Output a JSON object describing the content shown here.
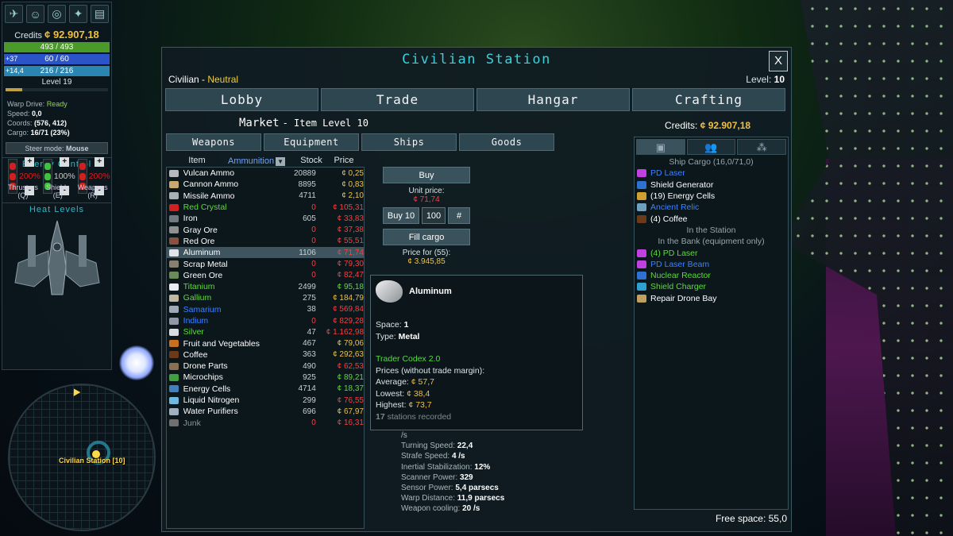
{
  "hud": {
    "credits_label": "Credits",
    "credits_value": "¢ 92.907,18",
    "hull": "493 / 493",
    "shield_side": "+37",
    "shield": "60 / 60",
    "energy_side": "+14,4",
    "energy": "216 / 216",
    "level": "Level 19",
    "stats": {
      "warp_label": "Warp Drive:",
      "warp_value": "Ready",
      "speed_label": "Speed:",
      "speed_value": "0,0",
      "coords_label": "Coords:",
      "coords_value": "(576, 412)",
      "cargo_label": "Cargo:",
      "cargo_value": "16/71 (23%)"
    },
    "steer_label": "Steer mode:",
    "steer_value": "Mouse",
    "energy_title": "Energy Control",
    "energy_cols": [
      {
        "pct": "200%",
        "label": "Thrusters",
        "key": "(Q)",
        "color": "#d02020"
      },
      {
        "pct": "100%",
        "label": "Shields",
        "key": "(E)",
        "color": "#40c040"
      },
      {
        "pct": "200%",
        "label": "Weapons",
        "key": "(R)",
        "color": "#d02020"
      }
    ],
    "heat_title": "Heat Levels"
  },
  "minimap": {
    "label": "Civilian Station [10]"
  },
  "window": {
    "title": "Civilian Station",
    "close": "X",
    "faction_name": "Civilian - ",
    "faction_status": "Neutral",
    "level_label": "Level: ",
    "level_value": "10",
    "tabs": [
      "Lobby",
      "Trade",
      "Hangar",
      "Crafting"
    ],
    "market_title": "Market",
    "market_sub": "- Item Level 10",
    "credits_label": "Credits: ",
    "credits_value": "¢ 92.907,18",
    "subtabs": [
      "Weapons",
      "Equipment",
      "Ships",
      "Goods"
    ]
  },
  "list": {
    "headers": {
      "item": "Item",
      "filter": "Ammunition",
      "stock": "Stock",
      "price": "Price"
    },
    "rows": [
      {
        "name": "Vulcan Ammo",
        "stock": "20889",
        "price": "¢ 0,25",
        "nc": "#ffffff",
        "pc": "#f0c040",
        "ic": "#b8b8c0"
      },
      {
        "name": "Cannon Ammo",
        "stock": "8895",
        "price": "¢ 0,83",
        "nc": "#ffffff",
        "pc": "#f0c040",
        "ic": "#c8a870"
      },
      {
        "name": "Missile Ammo",
        "stock": "4711",
        "price": "¢ 2,10",
        "nc": "#ffffff",
        "pc": "#f0c040",
        "ic": "#a8b0b8"
      },
      {
        "name": "Red Crystal",
        "stock": "0",
        "price": "¢ 105,31",
        "nc": "#5adc36",
        "pc": "#ff3c3c",
        "ic": "#d02020",
        "sc": "#ff3c3c"
      },
      {
        "name": "Iron",
        "stock": "605",
        "price": "¢ 33,83",
        "nc": "#ffffff",
        "pc": "#ff3c3c",
        "ic": "#707880"
      },
      {
        "name": "Gray Ore",
        "stock": "0",
        "price": "¢ 37,38",
        "nc": "#ffffff",
        "pc": "#ff3c3c",
        "ic": "#909090",
        "sc": "#ff3c3c"
      },
      {
        "name": "Red Ore",
        "stock": "0",
        "price": "¢ 55,51",
        "nc": "#ffffff",
        "pc": "#ff3c3c",
        "ic": "#8a5040",
        "sc": "#ff3c3c"
      },
      {
        "name": "Aluminum",
        "stock": "1106",
        "price": "¢ 71,74",
        "nc": "#ffffff",
        "pc": "#ff3c3c",
        "ic": "#e0e4e8",
        "sel": true
      },
      {
        "name": "Scrap Metal",
        "stock": "0",
        "price": "¢ 79,30",
        "nc": "#ffffff",
        "pc": "#ff3c3c",
        "ic": "#8a8070",
        "sc": "#ff3c3c"
      },
      {
        "name": "Green Ore",
        "stock": "0",
        "price": "¢ 82,47",
        "nc": "#ffffff",
        "pc": "#ff3c3c",
        "ic": "#6a8a5a",
        "sc": "#ff3c3c"
      },
      {
        "name": "Titanium",
        "stock": "2499",
        "price": "¢ 95,18",
        "nc": "#5adc36",
        "pc": "#5adc36",
        "ic": "#e8ecf0"
      },
      {
        "name": "Gallium",
        "stock": "275",
        "price": "¢ 184,79",
        "nc": "#5adc36",
        "pc": "#f0c040",
        "ic": "#c0b8a0"
      },
      {
        "name": "Samarium",
        "stock": "38",
        "price": "¢ 569,84",
        "nc": "#3a82ff",
        "pc": "#ff3c3c",
        "ic": "#a0a8b8"
      },
      {
        "name": "Indium",
        "stock": "0",
        "price": "¢ 829,28",
        "nc": "#3a82ff",
        "pc": "#ff3c3c",
        "ic": "#9098a8",
        "sc": "#ff3c3c"
      },
      {
        "name": "Silver",
        "stock": "47",
        "price": "¢ 1.162,98",
        "nc": "#5adc36",
        "pc": "#ff3c3c",
        "ic": "#d8dce0"
      },
      {
        "name": "Fruit and Vegetables",
        "stock": "467",
        "price": "¢ 79,06",
        "nc": "#ffffff",
        "pc": "#f0c040",
        "ic": "#c87020"
      },
      {
        "name": "Coffee",
        "stock": "363",
        "price": "¢ 292,63",
        "nc": "#ffffff",
        "pc": "#f0c040",
        "ic": "#6a3a1a"
      },
      {
        "name": "Drone Parts",
        "stock": "490",
        "price": "¢ 62,53",
        "nc": "#ffffff",
        "pc": "#ff3c3c",
        "ic": "#8a7050"
      },
      {
        "name": "Microchips",
        "stock": "925",
        "price": "¢ 89,21",
        "nc": "#ffffff",
        "pc": "#5adc36",
        "ic": "#40a040"
      },
      {
        "name": "Energy Cells",
        "stock": "4714",
        "price": "¢ 18,37",
        "nc": "#ffffff",
        "pc": "#5adc36",
        "ic": "#4080c0"
      },
      {
        "name": "Liquid Nitrogen",
        "stock": "299",
        "price": "¢ 76,55",
        "nc": "#ffffff",
        "pc": "#ff3c3c",
        "ic": "#70b8e0"
      },
      {
        "name": "Water Purifiers",
        "stock": "696",
        "price": "¢ 67,97",
        "nc": "#ffffff",
        "pc": "#f0c040",
        "ic": "#a0b0c0"
      },
      {
        "name": "Junk",
        "stock": "0",
        "price": "¢ 16,31",
        "nc": "#8a969a",
        "pc": "#ff3c3c",
        "ic": "#707070",
        "sc": "#ff3c3c"
      }
    ]
  },
  "trade": {
    "buy": "Buy",
    "unit_label": "Unit price:",
    "unit_value": "¢ 71,74",
    "buy10": "Buy 10",
    "qty": "100",
    "hash": "#",
    "fill": "Fill cargo",
    "price_for": "Price for (55):",
    "price_total": "¢ 3.945,85"
  },
  "tooltip": {
    "title": "Aluminum",
    "space_label": "Space: ",
    "space_value": "1",
    "type_label": "Type: ",
    "type_value": "Metal",
    "codex": "Trader Codex 2.0",
    "prices_label": "Prices (without trade margin):",
    "avg_label": "Average: ",
    "avg_value": "¢ 57,7",
    "low_label": "Lowest: ",
    "low_value": "¢ 38,4",
    "high_label": "Highest: ",
    "high_value": "¢ 73,7",
    "recorded_count": "17",
    "recorded_label": " stations recorded"
  },
  "shipstats": [
    {
      "label": "/s",
      "value": ""
    },
    {
      "label": "Turning Speed: ",
      "value": "22,4"
    },
    {
      "label": "Strafe Speed: ",
      "value": "4 /s"
    },
    {
      "label": "Inertial Stabilization: ",
      "value": "12%"
    },
    {
      "label": "Scanner Power: ",
      "value": "329"
    },
    {
      "label": "Sensor Power: ",
      "value": "5,4 parsecs"
    },
    {
      "label": "Warp Distance: ",
      "value": "11,9 parsecs"
    },
    {
      "label": "Weapon cooling: ",
      "value": "20 /s"
    }
  ],
  "cargo": {
    "tabs": [
      "▣",
      "👥",
      "⁂"
    ],
    "ship_header": "Ship Cargo (16,0/71,0)",
    "ship_items": [
      {
        "name": "PD Laser",
        "c": "#3a82ff",
        "ic": "#c040e0"
      },
      {
        "name": "Shield Generator",
        "c": "#ffffff",
        "ic": "#3070d0"
      },
      {
        "name": "(19) Energy Cells",
        "c": "#ffffff",
        "ic": "#d0a030"
      },
      {
        "name": "Ancient Relic",
        "c": "#3a82ff",
        "ic": "#70a0c0"
      },
      {
        "name": "(4) Coffee",
        "c": "#ffffff",
        "ic": "#6a3a1a"
      }
    ],
    "station_header": "In the Station",
    "bank_header": "In the Bank (equipment only)",
    "bank_items": [
      {
        "name": "(4) PD Laser",
        "c": "#5adc36",
        "ic": "#c040e0"
      },
      {
        "name": "PD Laser Beam",
        "c": "#3a82ff",
        "ic": "#c040e0"
      },
      {
        "name": "Nuclear Reactor",
        "c": "#5adc36",
        "ic": "#3070d0"
      },
      {
        "name": "Shield Charger",
        "c": "#5adc36",
        "ic": "#30a0d0"
      },
      {
        "name": "Repair Drone Bay",
        "c": "#ffffff",
        "ic": "#c0a060"
      }
    ],
    "free_space": "Free space: 55,0"
  }
}
